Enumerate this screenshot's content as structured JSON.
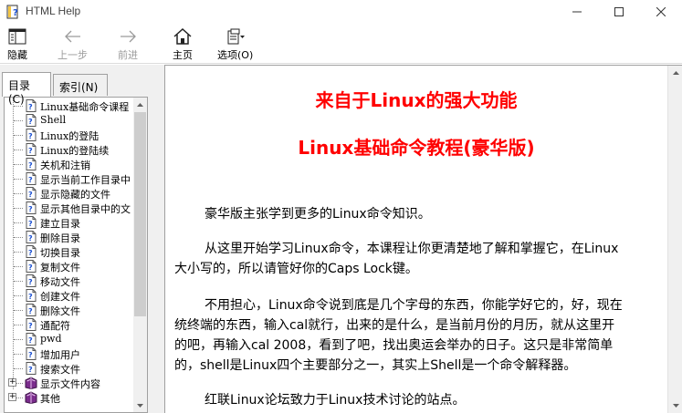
{
  "window": {
    "title": "HTML Help"
  },
  "toolbar": {
    "hide": "隐藏",
    "back": "上一步",
    "forward": "前进",
    "home": "主页",
    "options": "选项(O)"
  },
  "tabs": {
    "contents": "目录(C)",
    "index": "索引(N)"
  },
  "tree": {
    "items": [
      {
        "label": "Linux基础命令课程",
        "type": "page"
      },
      {
        "label": "Shell",
        "type": "page"
      },
      {
        "label": "Linux的登陆",
        "type": "page"
      },
      {
        "label": "Linux的登陆续",
        "type": "page"
      },
      {
        "label": "关机和注销",
        "type": "page"
      },
      {
        "label": "显示当前工作目录中",
        "type": "page"
      },
      {
        "label": "显示隐藏的文件",
        "type": "page"
      },
      {
        "label": "显示其他目录中的文",
        "type": "page"
      },
      {
        "label": "建立目录",
        "type": "page"
      },
      {
        "label": "删除目录",
        "type": "page"
      },
      {
        "label": "切换目录",
        "type": "page"
      },
      {
        "label": "复制文件",
        "type": "page"
      },
      {
        "label": "移动文件",
        "type": "page"
      },
      {
        "label": "创建文件",
        "type": "page"
      },
      {
        "label": "删除文件",
        "type": "page"
      },
      {
        "label": "通配符",
        "type": "page"
      },
      {
        "label": "pwd",
        "type": "page"
      },
      {
        "label": "增加用户",
        "type": "page"
      },
      {
        "label": "搜索文件",
        "type": "page"
      },
      {
        "label": "显示文件内容",
        "type": "book"
      },
      {
        "label": "其他",
        "type": "book"
      }
    ]
  },
  "content": {
    "title1": "来自于Linux的强大功能",
    "title2": "Linux基础命令教程(豪华版)",
    "p1": "豪华版主张学到更多的Linux命令知识。",
    "p2_l1": "从这里开始学习Linux命令，本课程让你更清楚地了解和掌握它，在Linux",
    "p2_l2": "大小写的，所以请管好你的Caps Lock键。",
    "p3_l1": "不用担心，Linux命令说到底是几个字母的东西，你能学好它的，好，现在",
    "p3_l2": "统终端的东西，输入cal就行，出来的是什么，是当前月份的月历，就从这里开",
    "p3_l3": "的吧，再输入cal 2008，看到了吧，找出奥运会举办的日子。这只是非常简单",
    "p3_l4": "的，shell是Linux四个主要部分之一，其实上Shell是一个命令解释器。",
    "p4": "红联Linux论坛致力于Linux技术讨论的站点。"
  },
  "colors": {
    "heading": "#ff0000"
  }
}
